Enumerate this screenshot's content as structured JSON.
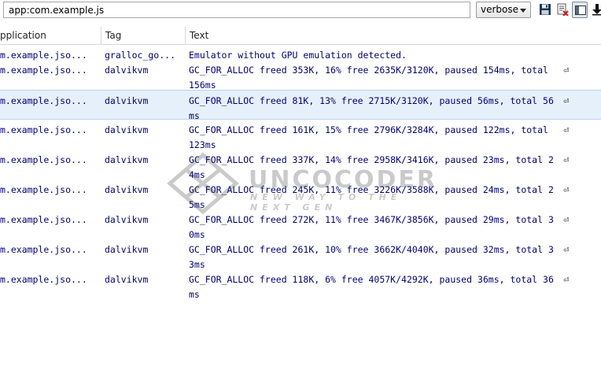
{
  "toolbar": {
    "filter_value": "app:com.example.js",
    "log_level": "verbose"
  },
  "columns": {
    "application": "pplication",
    "tag": "Tag",
    "text": "Text"
  },
  "rows": [
    {
      "app": "m.example.jso...",
      "tag": "gralloc_go...",
      "line1": "Emulator without GPU emulation detected.",
      "line2": "",
      "wrapped": false,
      "selected": false
    },
    {
      "app": "m.example.jso...",
      "tag": "dalvikvm",
      "line1": "GC_FOR_ALLOC freed 353K, 16% free 2635K/3120K, paused 154ms, total",
      "line2": "156ms",
      "wrapped": true,
      "selected": false
    },
    {
      "app": "m.example.jso...",
      "tag": "dalvikvm",
      "line1": "GC_FOR_ALLOC freed 81K, 13% free 2715K/3120K, paused 56ms, total 56",
      "line2": "ms",
      "wrapped": true,
      "selected": true
    },
    {
      "app": "m.example.jso...",
      "tag": "dalvikvm",
      "line1": "GC_FOR_ALLOC freed 161K, 15% free 2796K/3284K, paused 122ms, total",
      "line2": "123ms",
      "wrapped": true,
      "selected": false
    },
    {
      "app": "m.example.jso...",
      "tag": "dalvikvm",
      "line1": "GC_FOR_ALLOC freed 337K, 14% free 2958K/3416K, paused 23ms, total 2",
      "line2": "4ms",
      "wrapped": true,
      "selected": false
    },
    {
      "app": "m.example.jso...",
      "tag": "dalvikvm",
      "line1": "GC_FOR_ALLOC freed 245K, 11% free 3226K/3588K, paused 24ms, total 2",
      "line2": "5ms",
      "wrapped": true,
      "selected": false
    },
    {
      "app": "m.example.jso...",
      "tag": "dalvikvm",
      "line1": "GC_FOR_ALLOC freed 272K, 11% free 3467K/3856K, paused 29ms, total 3",
      "line2": "0ms",
      "wrapped": true,
      "selected": false
    },
    {
      "app": "m.example.jso...",
      "tag": "dalvikvm",
      "line1": "GC_FOR_ALLOC freed 261K, 10% free 3662K/4040K, paused 32ms, total 3",
      "line2": "3ms",
      "wrapped": true,
      "selected": false
    },
    {
      "app": "m.example.jso...",
      "tag": "dalvikvm",
      "line1": "GC_FOR_ALLOC freed 118K, 6% free 4057K/4292K, paused 36ms, total 36",
      "line2": "ms",
      "wrapped": true,
      "selected": false
    }
  ],
  "wrap_glyph": "⏎",
  "watermark": {
    "title": "UNCOCODER",
    "tagline": "NEW WAY TO THE NEXT GEN"
  }
}
